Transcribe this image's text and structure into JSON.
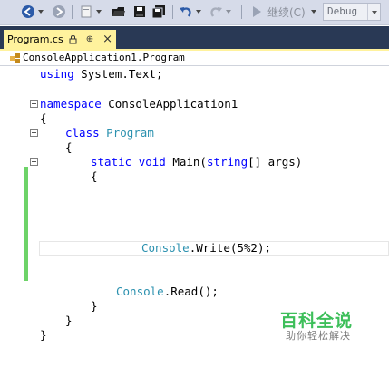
{
  "toolbar": {
    "continue_label": "继续(C)",
    "config_value": "Debug"
  },
  "tab": {
    "title": "Program.cs",
    "pin_glyph": "⊕",
    "close_glyph": "×"
  },
  "navbar": {
    "path": "ConsoleApplication1.Program"
  },
  "code": {
    "line_using_kw": "using",
    "line_using_rest": " System.Text;",
    "line_namespace_kw": "namespace",
    "line_namespace_rest": " ConsoleApplication1",
    "brace_open": "{",
    "brace_close": "}",
    "class_kw": "class",
    "class_name": "Program",
    "static_kw": "static",
    "void_kw": "void",
    "main_sig": " Main(",
    "string_kw": "string",
    "args_rest": "[] args)",
    "console_type": "Console",
    "write_call": ".Write(5%2);",
    "read_call": ".Read();"
  },
  "watermark": {
    "title": "百科全说",
    "subtitle": "助你轻松解决"
  },
  "colors": {
    "keyword": "#0000ff",
    "type": "#2b91af",
    "tab_active": "#fff29d",
    "tab_strip": "#293955",
    "change_indicator": "#6dd368"
  }
}
